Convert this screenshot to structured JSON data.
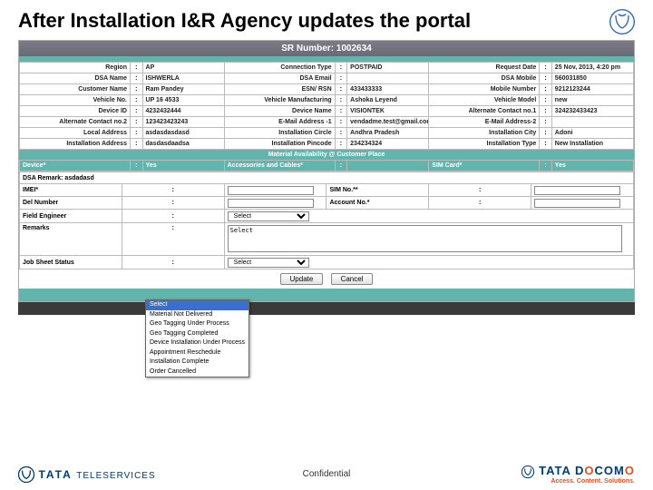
{
  "slide": {
    "title": "After Installation I&R Agency updates the portal"
  },
  "sr": {
    "label": "SR Number: 1002634"
  },
  "details": {
    "r1": {
      "l1": "Region",
      "v1": "AP",
      "l2": "Connection Type",
      "v2": "POSTPAID",
      "l3": "Request Date",
      "v3": "25 Nov, 2013, 4:20 pm"
    },
    "r2": {
      "l1": "DSA Name",
      "v1": "ISHWERLA",
      "l2": "DSA Email",
      "v2": "",
      "l3": "DSA Mobile",
      "v3": "560031850"
    },
    "r3": {
      "l1": "Customer Name",
      "v1": "Ram Pandey",
      "l2": "ESN/ RSN",
      "v2": "433433333",
      "l3": "Mobile Number",
      "v3": "9212123244"
    },
    "r4": {
      "l1": "Vehicle No.",
      "v1": "UP 16 4533",
      "l2": "Vehicle Manufacturing",
      "v2": "Ashoka Leyend",
      "l3": "Vehicle Model",
      "v3": "new"
    },
    "r5": {
      "l1": "Device ID",
      "v1": "4232432444",
      "l2": "Device Name",
      "v2": "VISIONTEK",
      "l3": "Alternate Contact no.1",
      "v3": "324232433423"
    },
    "r6": {
      "l1": "Alternate Contact no.2",
      "v1": "123423423243",
      "l2": "E-Mail Address -1",
      "v2": "vendadme.test@gmail.com",
      "l3": "E-Mail Address-2",
      "v3": ""
    },
    "r7": {
      "l1": "Local Address",
      "v1": "asdasdasdasd",
      "l2": "Installation Circle",
      "v2": "Andhra Pradesh",
      "l3": "Installation City",
      "v3": "Adoni"
    },
    "r8": {
      "l1": "Installation Address",
      "v1": "dasdasdaadsa",
      "l2": "Installation Pincode",
      "v2": "234234324",
      "l3": "Installation Type",
      "v3": "New Installation"
    }
  },
  "sectionHeader": "Material Availability @ Customer Place",
  "bookingRow": {
    "l1": "Device*",
    "c1": "Yes",
    "l2": "Accessories and Cables*",
    "c2": "",
    "l3": "SIM Card*",
    "c3": "Yes"
  },
  "form": {
    "row1": {
      "l": "DSA Remark: asdadasd"
    },
    "row2a": {
      "l": "IMEI*",
      "l2": "SIM No.**"
    },
    "row2b": {
      "l": "Del Number",
      "l2": "Account No.*"
    },
    "row3": {
      "l": "Field Engineer",
      "sel": "Select"
    },
    "row4": {
      "l": "Remarks",
      "val": "Select"
    },
    "row5": {
      "l": "Job Sheet Status",
      "sel": "Select"
    }
  },
  "dropdown": {
    "opt0": "Select",
    "opt1": "Material Not Delivered",
    "opt2": "Geo Tagging Under Process",
    "opt3": "Geo Tagging Completed",
    "opt4": "Device Installation Under Process",
    "opt5": "Appointment Reschedule",
    "opt6": "Installation Complete",
    "opt7": "Order Cancelled"
  },
  "buttons": {
    "update": "Update",
    "cancel": "Cancel"
  },
  "footer": {
    "center": "Confidential",
    "tata": "TATA",
    "tele": "TELESERVICES",
    "docomo1": "TATA",
    "docomo2": "DOCOMO",
    "tag1": "Access.",
    "tag2": "Content.",
    "tag3": "Solutions."
  }
}
